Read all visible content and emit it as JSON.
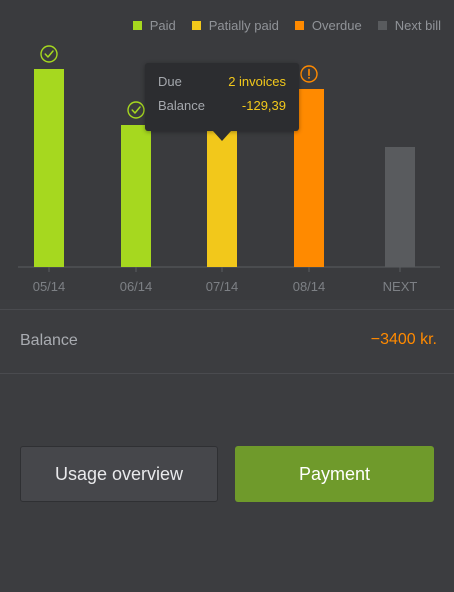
{
  "chart_data": {
    "type": "bar",
    "categories": [
      "05/14",
      "06/14",
      "07/14",
      "08/14",
      "NEXT"
    ],
    "values": [
      198,
      142,
      138,
      178,
      120
    ],
    "statuses": [
      "paid",
      "paid",
      "partially_paid",
      "overdue",
      "next_bill"
    ],
    "status_icons": [
      "check-icon",
      "check-icon",
      "",
      "alert-icon",
      ""
    ],
    "legend": [
      {
        "key": "paid",
        "label": "Paid",
        "color": "#a6d81f"
      },
      {
        "key": "partially_paid",
        "label": "Patially paid",
        "color": "#f2c81b"
      },
      {
        "key": "overdue",
        "label": "Overdue",
        "color": "#ff8a00"
      },
      {
        "key": "next_bill",
        "label": "Next bill",
        "color": "#595b5e"
      }
    ],
    "ylim": [
      0,
      210
    ],
    "grid": false,
    "legend_position": "top-right"
  },
  "tooltip": {
    "due_label": "Due",
    "due_value": "2 invoices",
    "balance_label": "Balance",
    "balance_value": "-129,39"
  },
  "balance": {
    "label": "Balance",
    "amount": "−3400  kr."
  },
  "buttons": {
    "usage_overview": "Usage overview",
    "payment": "Payment"
  },
  "colors": {
    "background": "#3c3d40",
    "accent_green": "#a6d81f",
    "button_green": "#6f9a2b",
    "negative_orange": "#ff8a00",
    "axis_label": "#7d8085"
  }
}
